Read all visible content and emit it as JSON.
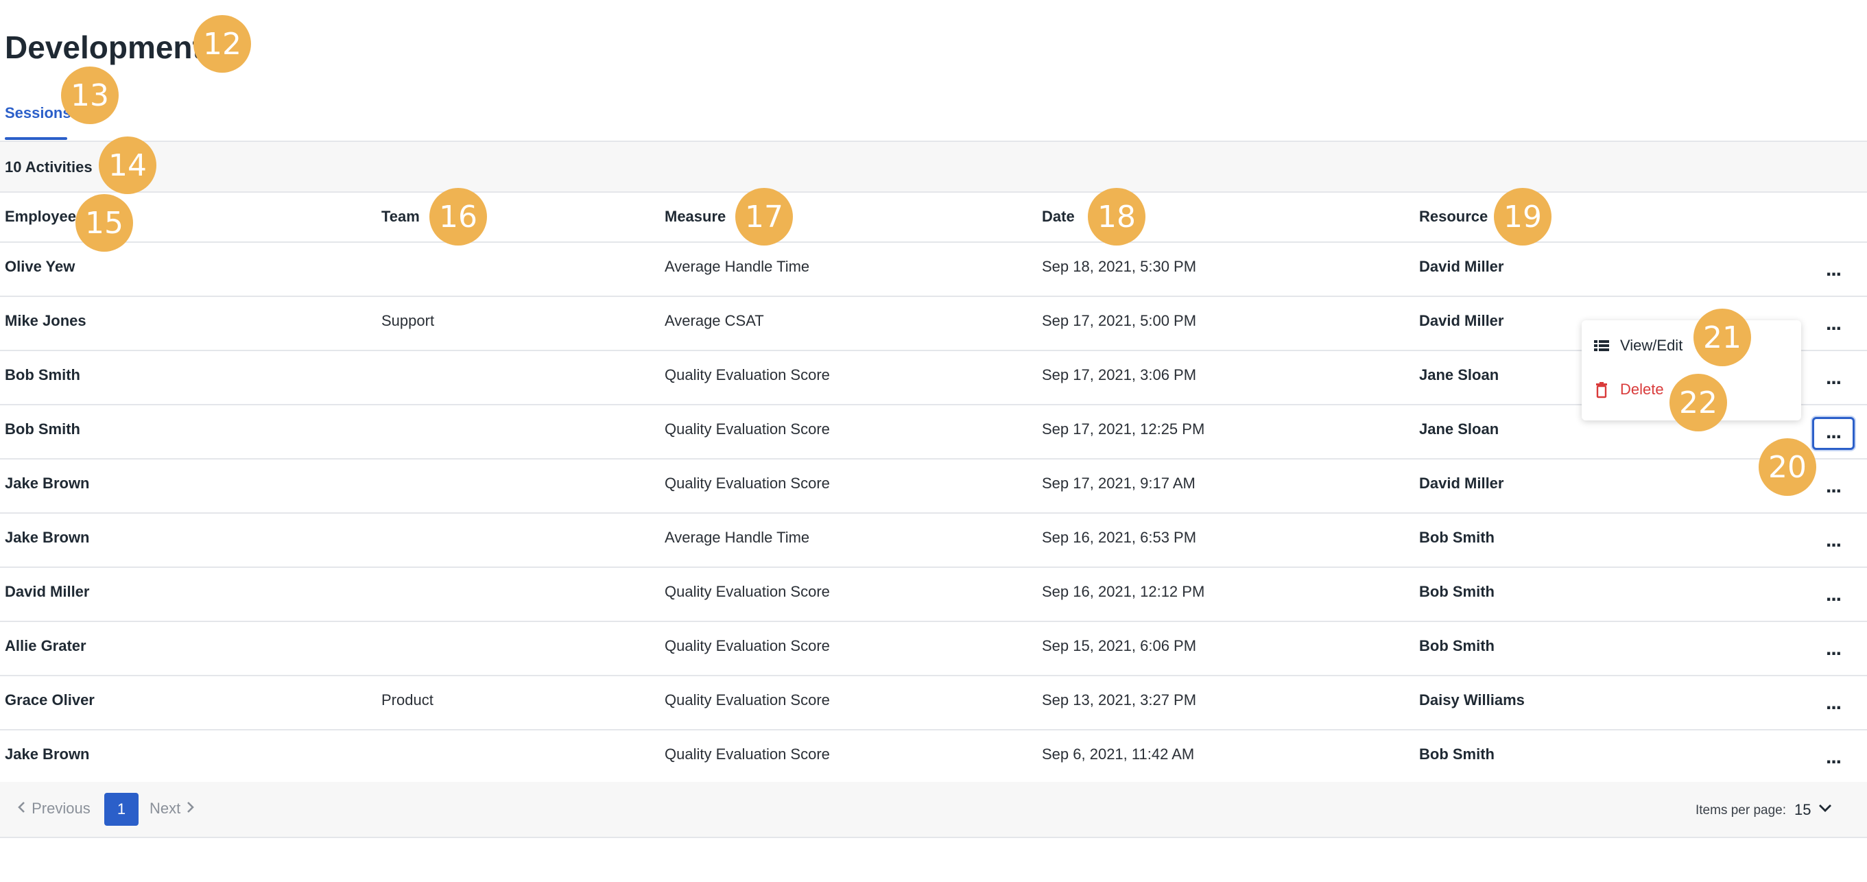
{
  "page": {
    "title": "Development"
  },
  "tabs": [
    {
      "label": "Sessions",
      "active": true
    }
  ],
  "activity_count": "10 Activities",
  "columns": {
    "employee": "Employee",
    "team": "Team",
    "measure": "Measure",
    "date": "Date",
    "resource": "Resource"
  },
  "rows": [
    {
      "employee": "Olive Yew",
      "team": "",
      "measure": "Average Handle Time",
      "date": "Sep 18, 2021, 5:30 PM",
      "resource": "David Miller"
    },
    {
      "employee": "Mike Jones",
      "team": "Support",
      "measure": "Average CSAT",
      "date": "Sep 17, 2021, 5:00 PM",
      "resource": "David Miller"
    },
    {
      "employee": "Bob Smith",
      "team": "",
      "measure": "Quality Evaluation Score",
      "date": "Sep 17, 2021, 3:06 PM",
      "resource": "Jane Sloan"
    },
    {
      "employee": "Bob Smith",
      "team": "",
      "measure": "Quality Evaluation Score",
      "date": "Sep 17, 2021, 12:25 PM",
      "resource": "Jane Sloan"
    },
    {
      "employee": "Jake Brown",
      "team": "",
      "measure": "Quality Evaluation Score",
      "date": "Sep 17, 2021, 9:17 AM",
      "resource": "David Miller"
    },
    {
      "employee": "Jake Brown",
      "team": "",
      "measure": "Average Handle Time",
      "date": "Sep 16, 2021, 6:53 PM",
      "resource": "Bob Smith"
    },
    {
      "employee": "David Miller",
      "team": "",
      "measure": "Quality Evaluation Score",
      "date": "Sep 16, 2021, 12:12 PM",
      "resource": "Bob Smith"
    },
    {
      "employee": "Allie Grater",
      "team": "",
      "measure": "Quality Evaluation Score",
      "date": "Sep 15, 2021, 6:06 PM",
      "resource": "Bob Smith"
    },
    {
      "employee": "Grace Oliver",
      "team": "Product",
      "measure": "Quality Evaluation Score",
      "date": "Sep 13, 2021, 3:27 PM",
      "resource": "Daisy Williams"
    },
    {
      "employee": "Jake Brown",
      "team": "",
      "measure": "Quality Evaluation Score",
      "date": "Sep 6, 2021, 11:42 AM",
      "resource": "Bob Smith"
    }
  ],
  "row_actions": {
    "icon": "more-horizontal-icon",
    "label": "..."
  },
  "context_menu": {
    "items": [
      {
        "label": "View/Edit",
        "icon": "list-icon"
      },
      {
        "label": "Delete",
        "icon": "trash-icon",
        "color": "#d93b3b"
      }
    ]
  },
  "pagination": {
    "previous": "Previous",
    "next": "Next",
    "current_page": "1",
    "items_per_page_label": "Items per page:",
    "items_per_page_value": "15"
  },
  "annotations": [
    "12",
    "13",
    "14",
    "15",
    "16",
    "17",
    "18",
    "19",
    "20",
    "21",
    "22"
  ],
  "colors": {
    "accent": "#2b5fc9",
    "danger": "#d93b3b",
    "annotation": "#efb352",
    "text": "#1f2933"
  }
}
